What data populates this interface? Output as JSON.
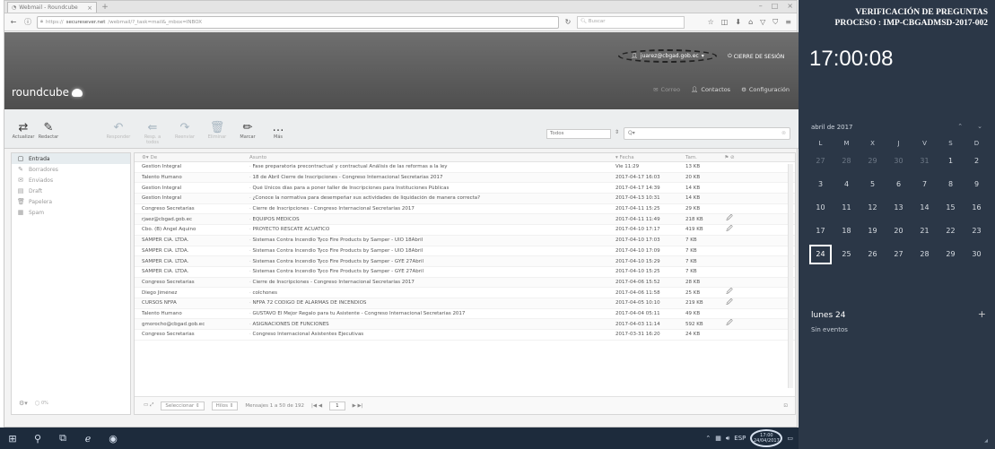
{
  "browser": {
    "tab_title": "Webmail - Roundcube",
    "url_prefix": "https://",
    "url_domain": "securesever.net",
    "url_rest": "/webmail/?_task=mail&_mbox=INBOX",
    "search_placeholder": "Buscar"
  },
  "header": {
    "logo": "roundcube",
    "user_email": "juarez@cbgad.gob.ec",
    "logout": "CIERRE DE SESIÓN",
    "nav": {
      "mail": "Correo",
      "contacts": "Contactos",
      "settings": "Configuración"
    }
  },
  "toolbar": {
    "refresh": "Actualizar",
    "compose": "Redactar",
    "reply": "Responder",
    "reply_all": "Resp. a todos",
    "forward": "Reenviar",
    "delete": "Eliminar",
    "mark": "Marcar",
    "more": "Más",
    "filter": "Todos",
    "search_placeholder": "Q▾"
  },
  "folders": [
    {
      "name": "Entrada",
      "icon": "inbox-icon",
      "active": true
    },
    {
      "name": "Borradores",
      "icon": "pencil-icon",
      "active": false
    },
    {
      "name": "Enviados",
      "icon": "send-icon",
      "active": false
    },
    {
      "name": "Draft",
      "icon": "draft-icon",
      "active": false
    },
    {
      "name": "Papelera",
      "icon": "trash-icon",
      "active": false
    },
    {
      "name": "Spam",
      "icon": "spam-icon",
      "active": false
    }
  ],
  "quota": "0%",
  "list_header": {
    "from": "De",
    "subject": "Asunto",
    "date": "Fecha",
    "size": "Tam."
  },
  "messages": [
    {
      "from": "Gestion Integral",
      "subject": "Fase preparatoria precontractual y contractual Análisis de las reformas a la ley",
      "date": "Vie 11:29",
      "size": "13 KB",
      "attach": false
    },
    {
      "from": "Talento Humano",
      "subject": "18 de Abril Cierre de Inscripciones - Congreso Internacional Secretarías 2017",
      "date": "2017-04-17 16:03",
      "size": "20 KB",
      "attach": false
    },
    {
      "from": "Gestion Integral",
      "subject": "Qué Únicos días para a poner taller de Inscripciones para Instituciones Públicas",
      "date": "2017-04-17 14:39",
      "size": "14 KB",
      "attach": false
    },
    {
      "from": "Gestion Integral",
      "subject": "¿Conoce la normativa para desempeñar sus actividades de liquidación de manera correcta?",
      "date": "2017-04-13 10:31",
      "size": "14 KB",
      "attach": false
    },
    {
      "from": "Congreso Secretarías",
      "subject": "Cierre de Inscripciones - Congreso Internacional Secretarías 2017",
      "date": "2017-04-11 15:25",
      "size": "29 KB",
      "attach": false
    },
    {
      "from": "rjaez@cbgad.gob.ec",
      "subject": "EQUIPOS MÉDICOS",
      "date": "2017-04-11 11:49",
      "size": "218 KB",
      "attach": true
    },
    {
      "from": "Cbo. (B) Angel Aquino",
      "subject": "PROYECTO RESCATE ACUÁTICO",
      "date": "2017-04-10 17:17",
      "size": "419 KB",
      "attach": true
    },
    {
      "from": "SAMPER CIA. LTDA.",
      "subject": "Sistemas Contra Incendio Tyco Fire Products by Samper - UIO 18Abril",
      "date": "2017-04-10 17:03",
      "size": "7 KB",
      "attach": false
    },
    {
      "from": "SAMPER CIA. LTDA.",
      "subject": "Sistemas Contra Incendio Tyco Fire Products by Samper - UIO 18Abril",
      "date": "2017-04-10 17:09",
      "size": "7 KB",
      "attach": false
    },
    {
      "from": "SAMPER CIA. LTDA.",
      "subject": "Sistemas Contra Incendio Tyco Fire Products by Samper - GYE 27Abril",
      "date": "2017-04-10 15:29",
      "size": "7 KB",
      "attach": false
    },
    {
      "from": "SAMPER CIA. LTDA.",
      "subject": "Sistemas Contra Incendio Tyco Fire Products by Samper - GYE 27Abril",
      "date": "2017-04-10 15:25",
      "size": "7 KB",
      "attach": false
    },
    {
      "from": "Congreso Secretarías",
      "subject": "Cierre de Inscripciones - Congreso Internacional Secretarías 2017",
      "date": "2017-04-06 15:52",
      "size": "28 KB",
      "attach": false
    },
    {
      "from": "Diego Jiménez",
      "subject": "colchones",
      "date": "2017-04-06 11:58",
      "size": "25 KB",
      "attach": true
    },
    {
      "from": "CURSOS NFPA",
      "subject": "NFPA 72 CÓDIGO DE ALARMAS DE INCENDIOS",
      "date": "2017-04-05 10:10",
      "size": "219 KB",
      "attach": true
    },
    {
      "from": "Talento Humano",
      "subject": "GUSTAVO El Mejor Regalo para tu Asistente - Congreso Internacional Secretarías 2017",
      "date": "2017-04-04 05:11",
      "size": "49 KB",
      "attach": false
    },
    {
      "from": "gmorocho@cbgad.gob.ec",
      "subject": "ASIGNACIONES DE FUNCIONES",
      "date": "2017-04-03 11:14",
      "size": "592 KB",
      "attach": true
    },
    {
      "from": "Congreso Secretarías",
      "subject": "Congreso Internacional Asistentes Ejecutivas",
      "date": "2017-03-31 16:20",
      "size": "24 KB",
      "attach": false
    }
  ],
  "list_footer": {
    "select": "Seleccionar",
    "threads": "Hilos",
    "count": "Mensajes 1 a 50 de 192",
    "page": "1"
  },
  "taskbar": {
    "time": "17:00",
    "date": "24/04/2017"
  },
  "panel": {
    "title_line1": "VERIFICACIÓN DE PREGUNTAS",
    "title_line2": "PROCESO : IMP-CBGADMSD-2017-002",
    "time": "17:00:08",
    "month": "abril de 2017",
    "dow": [
      "L",
      "M",
      "X",
      "J",
      "V",
      "S",
      "D"
    ],
    "weeks": [
      [
        "27",
        "28",
        "29",
        "30",
        "31",
        "1",
        "2"
      ],
      [
        "3",
        "4",
        "5",
        "6",
        "7",
        "8",
        "9"
      ],
      [
        "10",
        "11",
        "12",
        "13",
        "14",
        "15",
        "16"
      ],
      [
        "17",
        "18",
        "19",
        "20",
        "21",
        "22",
        "23"
      ],
      [
        "24",
        "25",
        "26",
        "27",
        "28",
        "29",
        "30"
      ]
    ],
    "day_label": "lunes 24",
    "events": "Sin eventos"
  }
}
